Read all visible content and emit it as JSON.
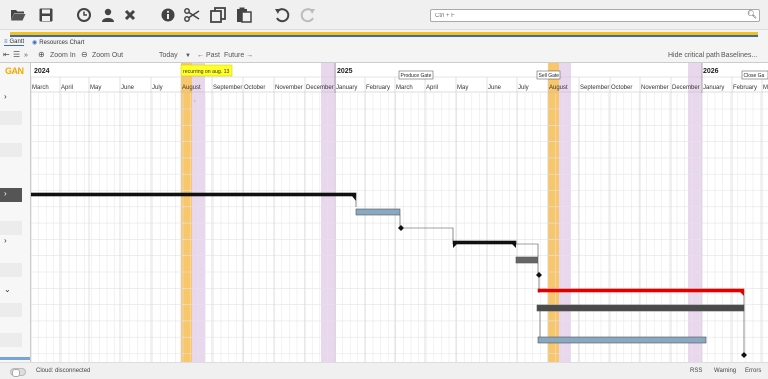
{
  "toolbar": {
    "icons": [
      "folder-open-icon",
      "save-icon",
      "clock-icon",
      "user-icon",
      "close-icon",
      "info-icon",
      "scissors-icon",
      "copy-icon",
      "paste-icon",
      "undo-icon",
      "redo-icon"
    ]
  },
  "search": {
    "placeholder": "Ctrl + F"
  },
  "tabs": [
    {
      "label": "Gantt",
      "active": true
    },
    {
      "label": "Resources Chart",
      "active": false
    }
  ],
  "gantt_toolbar": {
    "zoom_in": "Zoom In",
    "zoom_out": "Zoom Out",
    "today": "Today",
    "past": "← Past",
    "future": "Future →",
    "hide_critical": "Hide critical path",
    "baselines": "Baselines..."
  },
  "timeline": {
    "logo": "GAN",
    "years": [
      "2024",
      "2025",
      "2026"
    ],
    "months": [
      "March",
      "April",
      "May",
      "June",
      "July",
      "August",
      "September",
      "October",
      "November",
      "December",
      "January",
      "February",
      "March",
      "April",
      "May",
      "June",
      "July",
      "August",
      "September",
      "October",
      "November",
      "December",
      "January",
      "February",
      "M"
    ],
    "milestone_labels": [
      "Produce Gate",
      "Sell Gate",
      "Close Ga"
    ],
    "recurring_note": "recurring on aug. 13"
  },
  "colors": {
    "highlight_orange": "#f9c76b",
    "highlight_purple": "#e9d7ee",
    "task_black": "#111111",
    "task_blue": "#89a8c2",
    "task_red": "#e00000",
    "task_dark": "#3a3a3a",
    "brand_yellow": "#f2c318",
    "brand_blue": "#4069b0"
  },
  "status": {
    "cloud": "Cloud: disconnected",
    "rss": "RSS",
    "warning": "Warning",
    "errors": "Errors"
  }
}
